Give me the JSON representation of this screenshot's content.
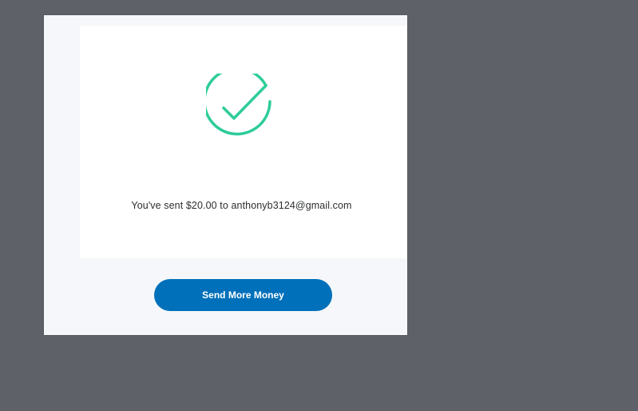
{
  "confirmation": {
    "message": "You've sent $20.00 to anthonyb3124@gmail.com",
    "icon": "success-check-icon",
    "icon_color": "#2ecc9a"
  },
  "actions": {
    "send_more_label": "Send More Money",
    "button_color": "#0070ba"
  }
}
